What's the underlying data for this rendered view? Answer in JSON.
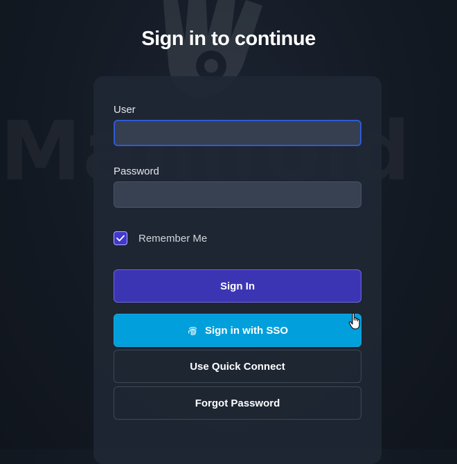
{
  "page": {
    "title": "Sign in to continue"
  },
  "background": {
    "brand_text": "Manifold"
  },
  "form": {
    "user_label": "User",
    "user_value": "",
    "password_label": "Password",
    "password_value": "",
    "remember_label": "Remember Me",
    "remember_checked": true
  },
  "buttons": {
    "sign_in": "Sign In",
    "sso": "Sign in with SSO",
    "quick_connect": "Use Quick Connect",
    "forgot_password": "Forgot Password"
  },
  "icons": {
    "checkbox": "check-icon",
    "sso": "fingerprint-icon",
    "cursor": "hand-pointer-icon",
    "background": "hand-logo-icon"
  },
  "colors": {
    "background": "#131922",
    "card": "#1f2734",
    "primary": "#3c35b3",
    "sso": "#019fdb",
    "focus_border": "#2f5bd6",
    "checkbox": "#4338ca"
  }
}
